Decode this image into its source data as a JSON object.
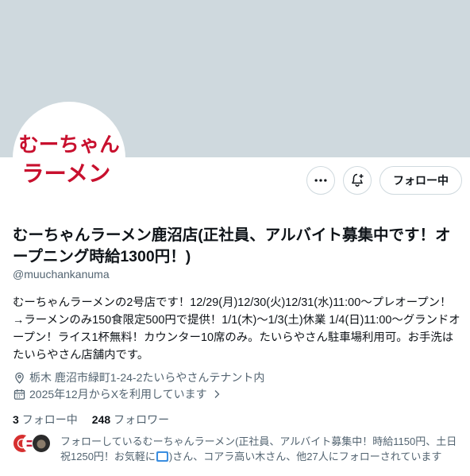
{
  "colors": {
    "banner": "#cfd9de",
    "text": "#0f1419",
    "secondary": "#536471",
    "logo_red": "#c8102e"
  },
  "avatar": {
    "logo_text_line1": "むーちゃん",
    "logo_text_line2": "ラーメン"
  },
  "actions": {
    "more_icon": "more-horizontal-icon",
    "notify_icon": "bell-plus-icon",
    "follow_label": "フォロー中"
  },
  "profile": {
    "name": "むーちゃんラーメン鹿沼店(正社員、アルバイト募集中です！オープニング時給1300円！)",
    "handle": "@muuchankanuma",
    "bio": "むーちゃんラーメンの2号店です！12/29(月)12/30(火)12/31(水)11:00～プレオープン！→ラーメンのみ150食限定500円で提供！1/1(木)～1/3(土)休業 1/4(日)11:00～グランドオープン！ライス1杯無料！カウンター10席のみ。たいらやさん駐車場利用可。お手洗はたいらやさん店舗内です。",
    "location": "栃木 鹿沼市緑町1-24-2たいらやさんテナント内",
    "joined": "2025年12月からXを利用しています"
  },
  "counts": {
    "following_value": "3",
    "following_label": "フォロー中",
    "followers_value": "248",
    "followers_label": "フォロワー"
  },
  "followed_by": {
    "text_before": "フォローしているむーちゃんラーメン(正社員、アルバイト募集中！時給1150円、土日祝1250円！お気軽に",
    "text_after": ")さん、コアラ高い木さん、他27人にフォローされています"
  }
}
